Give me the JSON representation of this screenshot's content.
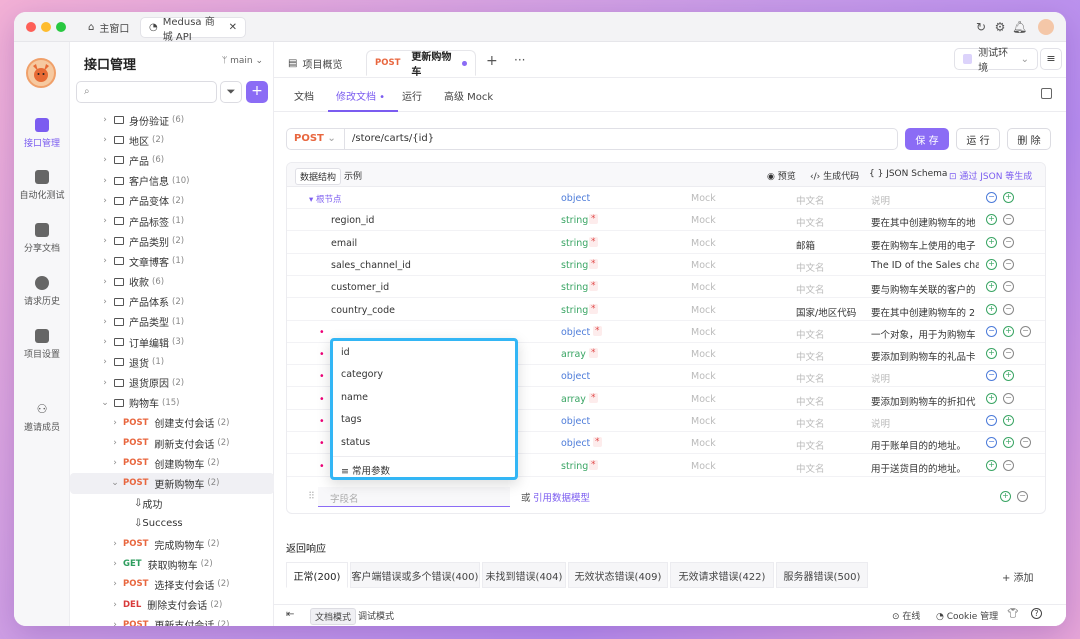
{
  "titlebar": {
    "home_tab": "主窗口",
    "project_tab": "Medusa 商城 API"
  },
  "rail": {
    "items": [
      {
        "label": "接口管理",
        "icon": "api-icon"
      },
      {
        "label": "自动化测试",
        "icon": "automation-icon"
      },
      {
        "label": "分享文档",
        "icon": "share-doc-icon"
      },
      {
        "label": "请求历史",
        "icon": "history-icon"
      },
      {
        "label": "项目设置",
        "icon": "settings-icon"
      },
      {
        "label": "邀请成员",
        "icon": "invite-member-icon"
      }
    ]
  },
  "tree": {
    "title": "接口管理",
    "branch": "main",
    "folders": [
      [
        "身份验证",
        "(6)"
      ],
      [
        "地区",
        "(2)"
      ],
      [
        "产品",
        "(6)"
      ],
      [
        "客户信息",
        "(10)"
      ],
      [
        "产品变体",
        "(2)"
      ],
      [
        "产品标签",
        "(1)"
      ],
      [
        "产品类别",
        "(2)"
      ],
      [
        "文章博客",
        "(1)"
      ],
      [
        "收款",
        "(6)"
      ],
      [
        "产品体系",
        "(2)"
      ],
      [
        "产品类型",
        "(1)"
      ],
      [
        "订单编辑",
        "(3)"
      ],
      [
        "退货",
        "(1)"
      ],
      [
        "退货原因",
        "(2)"
      ],
      [
        "购物车",
        "(15)"
      ]
    ],
    "cart_items": [
      [
        "POST",
        "创建支付会话",
        "(2)"
      ],
      [
        "POST",
        "刷新支付会话",
        "(2)"
      ],
      [
        "POST",
        "创建购物车",
        "(2)"
      ],
      [
        "POST",
        "更新购物车",
        "(2)"
      ]
    ],
    "examples": [
      "成功",
      "Success"
    ],
    "more_items": [
      [
        "POST",
        "完成购物车",
        "(2)"
      ],
      [
        "GET",
        "获取购物车",
        "(2)"
      ],
      [
        "POST",
        "选择支付会话",
        "(2)"
      ],
      [
        "DEL",
        "删除支付会话",
        "(2)"
      ],
      [
        "POST",
        "更新支付会话",
        "(2)"
      ]
    ]
  },
  "doctabs": {
    "overview": "项目概览",
    "method": "POST",
    "name": "更新购物车",
    "env": "测试环境"
  },
  "subtabs": [
    "文档",
    "修改文档",
    "运行",
    "高级 Mock"
  ],
  "url": {
    "method": "POST",
    "path": "/store/carts/{id}",
    "save": "保 存",
    "run": "运 行",
    "delete": "删 除"
  },
  "gridtool": {
    "left": [
      "数据结构",
      "示例"
    ],
    "right": [
      "预览",
      "生成代码",
      "JSON Schema",
      "通过 JSON 等生成"
    ]
  },
  "placeholders": {
    "mock": "Mock",
    "cn": "中文名",
    "desc": "说明"
  },
  "rows": [
    {
      "name": "根节点",
      "type": "object",
      "req": false,
      "cn": "",
      "desc": "",
      "root": true
    },
    {
      "name": "region_id",
      "type": "string",
      "req": true,
      "cn": "",
      "desc": "要在其中创建购物车的地"
    },
    {
      "name": "email",
      "type": "string",
      "req": true,
      "cn": "邮箱",
      "desc": "要在购物车上使用的电子"
    },
    {
      "name": "sales_channel_id",
      "type": "string",
      "req": true,
      "cn": "",
      "desc": "The ID of the Sales chan"
    },
    {
      "name": "customer_id",
      "type": "string",
      "req": true,
      "cn": "",
      "desc": "要与购物车关联的客户的"
    },
    {
      "name": "country_code",
      "type": "string",
      "req": true,
      "cn": "国家/地区代码",
      "desc": "要在其中创建购物车的 2"
    },
    {
      "name": "",
      "type": "object",
      "req": true,
      "cn": "",
      "desc": "一个对象，用于为购物车"
    },
    {
      "name": "",
      "type": "array",
      "req": true,
      "cn": "",
      "desc": "要添加到购物车的礼品卡"
    },
    {
      "name": "",
      "type": "object",
      "req": false,
      "cn": "",
      "desc": ""
    },
    {
      "name": "",
      "type": "array",
      "req": true,
      "cn": "",
      "desc": "要添加到购物车的折扣代"
    },
    {
      "name": "",
      "type": "object",
      "req": false,
      "cn": "",
      "desc": ""
    },
    {
      "name": "",
      "type": "object",
      "req": true,
      "cn": "",
      "desc": "用于账单目的的地址。"
    },
    {
      "name": "",
      "type": "string",
      "req": true,
      "cn": "",
      "desc": "用于送货目的的地址。"
    }
  ],
  "field": {
    "placeholder": "字段名",
    "or": "或",
    "ref": "引用数据模型"
  },
  "popup": {
    "items": [
      "id",
      "category",
      "name",
      "tags",
      "status"
    ],
    "footer": "常用参数"
  },
  "response": {
    "title": "返回响应",
    "tabs": [
      "正常(200)",
      "客户端错误或多个错误(400)",
      "未找到错误(404)",
      "无效状态错误(409)",
      "无效请求错误(422)",
      "服务器错误(500)"
    ],
    "add": "+ 添加"
  },
  "bottom": {
    "doc_mode": "文档模式",
    "debug_mode": "调试模式",
    "online": "在线",
    "cookie": "Cookie 管理"
  }
}
